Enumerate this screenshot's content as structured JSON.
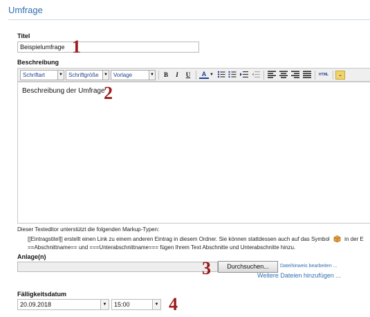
{
  "page": {
    "title": "Umfrage"
  },
  "title_field": {
    "label": "Titel",
    "value": "Beispielumfrage"
  },
  "description": {
    "label": "Beschreibung",
    "toolbar": {
      "font_select": "Schriftart",
      "size_select": "Schriftgröße",
      "template_select": "Vorlage",
      "bold": "B",
      "italic": "I",
      "underline": "U",
      "font_color": "A",
      "html_label": "HTML"
    },
    "content": "Beschreibung der Umfrage"
  },
  "markup_help": {
    "intro": "Dieser Texteditor unterstützt die folgenden Markup-Typen:",
    "line1_before": "[[Eintragstitel]] erstellt einen Link zu einem anderen Eintrag in diesem Ordner. Sie können stattdessen auch auf das Symbol",
    "line1_after": "in der E",
    "line2": "==Abschnittname== und ===Unterabschnittname=== fügen Ihrem Text Abschnitte und Unterabschnitte hinzu."
  },
  "attachment": {
    "label": "Anlage(n)",
    "browse": "Durchsuchen...",
    "edit_hint": "Dateihinweis bearbeiten ...",
    "add_more": "Weitere Dateien hinzufügen ..."
  },
  "due_date": {
    "label": "Fälligkeitsdatum",
    "date": "20.09.2018",
    "time": "15:00"
  },
  "markers": {
    "m1": "1",
    "m2": "2",
    "m3": "3",
    "m4": "4"
  },
  "colors": {
    "accent": "#2f6fb0",
    "marker": "#9a1b1b"
  },
  "icons": [
    "bold-icon",
    "italic-icon",
    "underline-icon",
    "font-color-icon",
    "bullet-list-icon",
    "numbered-list-icon",
    "indent-icon",
    "outdent-icon",
    "align-left-icon",
    "align-center-icon",
    "align-right-icon",
    "justify-icon",
    "html-icon",
    "more-options-icon",
    "package-icon"
  ]
}
